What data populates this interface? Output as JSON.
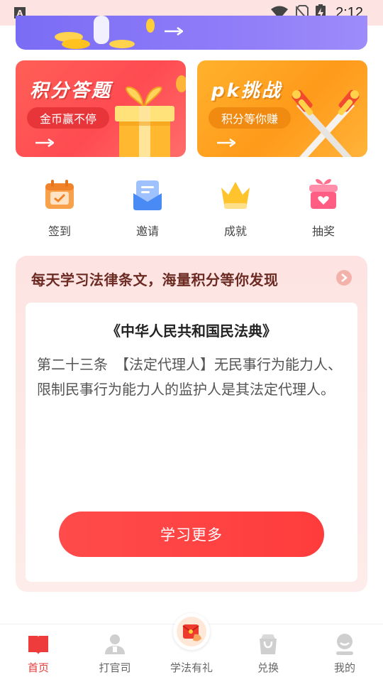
{
  "status_bar": {
    "app_icon_letter": "A",
    "time": "2:12"
  },
  "cards": [
    {
      "title": "积分答题",
      "pill": "金币赢不停"
    },
    {
      "title": "pk挑战",
      "pill": "积分等你赚"
    }
  ],
  "quick_actions": [
    {
      "label": "签到",
      "icon": "calendar-check-icon"
    },
    {
      "label": "邀请",
      "icon": "envelope-icon"
    },
    {
      "label": "成就",
      "icon": "crown-icon"
    },
    {
      "label": "抽奖",
      "icon": "gift-box-icon"
    }
  ],
  "law": {
    "heading": "每天学习法律条文，海量积分等你发现",
    "book_title": "《中华人民共和国民法典》",
    "article_text": "第二十三条　【法定代理人】无民事行为能力人、限制民事行为能力人的监护人是其法定代理人。",
    "button": "学习更多"
  },
  "bottom_nav": [
    {
      "label": "首页",
      "icon": "book-icon",
      "active": true
    },
    {
      "label": "打官司",
      "icon": "lawyer-icon",
      "active": false
    },
    {
      "label": "学法有礼",
      "icon": "red-envelope-icon",
      "active": false
    },
    {
      "label": "兑换",
      "icon": "shopping-bag-icon",
      "active": false
    },
    {
      "label": "我的",
      "icon": "user-icon",
      "active": false
    }
  ],
  "colors": {
    "accent_red": "#ff4040",
    "status_bar_bg": "#fde3e1",
    "law_heading": "#6b2a22"
  }
}
